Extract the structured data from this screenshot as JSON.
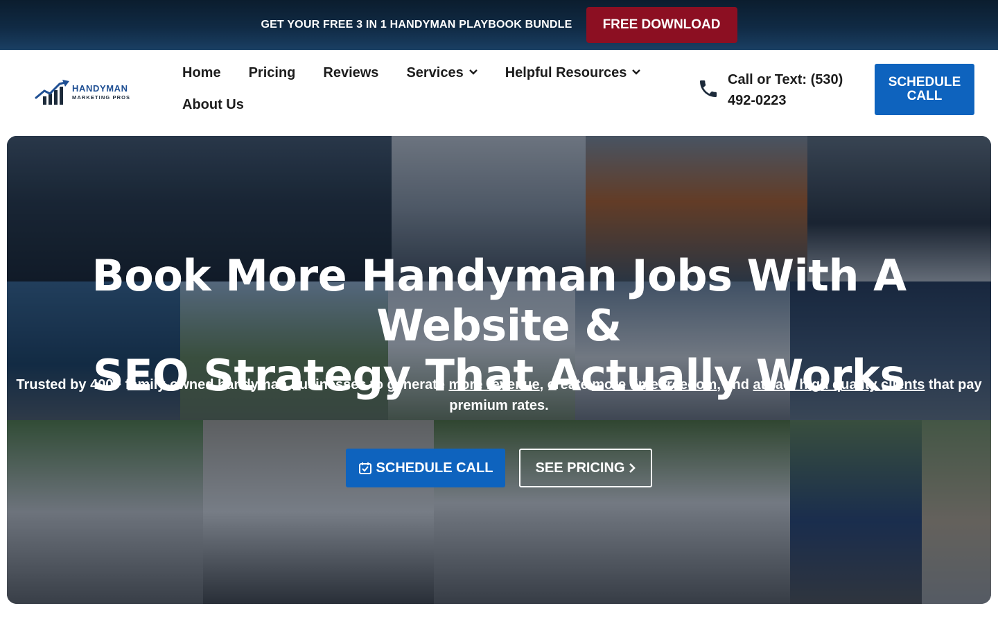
{
  "promo": {
    "text": "GET YOUR FREE 3 IN 1 HANDYMAN PLAYBOOK BUNDLE",
    "button_label": "FREE DOWNLOAD"
  },
  "header": {
    "logo": {
      "line1": "HANDYMAN",
      "line2": "MARKETING PROS"
    },
    "nav": [
      {
        "label": "Home"
      },
      {
        "label": "Pricing"
      },
      {
        "label": "Reviews"
      },
      {
        "label": "Services",
        "icon": "chevron-down-icon"
      },
      {
        "label": "Helpful Resources",
        "icon": "chevron-down-icon"
      },
      {
        "label": "About Us"
      }
    ],
    "phone": {
      "icon": "phone-icon",
      "label": "Call or Text: (530) 492-0223"
    },
    "schedule_button": "SCHEDULE CALL"
  },
  "hero": {
    "title_line1": "Book More Handyman Jobs With A Website &",
    "title_line2": "SEO Strategy That Actually Works",
    "subtitle": {
      "part1": "Trusted by 400+ family-owned handyman businesses to generate ",
      "link1": "more revenue",
      "part2": ", create ",
      "link2": "more time freedom",
      "part3": ", and ",
      "link3": "attract high quality clients",
      "part4": " that pay premium rates."
    },
    "cta_primary": {
      "label": "SCHEDULE CALL",
      "icon": "calendar-check-icon"
    },
    "cta_secondary": {
      "label": "SEE PRICING",
      "icon": "chevron-right-icon"
    }
  },
  "colors": {
    "promo_button": "#8c0f22",
    "primary_blue": "#0e63be",
    "logo_blue": "#1f4f93"
  }
}
